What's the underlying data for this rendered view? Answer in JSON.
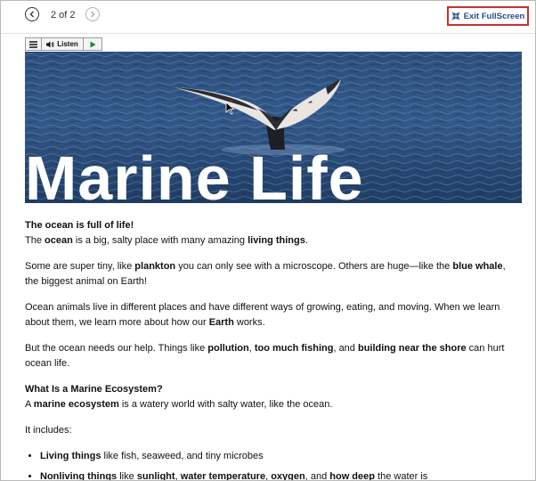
{
  "toolbar": {
    "pager_text": "2 of 2",
    "exit_label": "Exit FullScreen"
  },
  "readspeaker": {
    "listen_label": "Listen"
  },
  "hero": {
    "title": "Marine Life"
  },
  "article": {
    "intro_heading": "The ocean is full of life!",
    "p1": [
      "The ",
      "ocean",
      " is a big, salty place with many amazing ",
      "living things",
      "."
    ],
    "p2": [
      "Some are super tiny, like ",
      "plankton",
      " you can only see with a microscope. Others are huge—like the ",
      "blue whale",
      ", the biggest animal on Earth!"
    ],
    "p3": [
      "Ocean animals live in different places and have different ways of growing, eating, and moving. When we learn about them, we learn more about how our ",
      "Earth",
      " works."
    ],
    "p4": [
      "But the ocean needs our help. Things like ",
      "pollution",
      ", ",
      "too much fishing",
      ", and ",
      "building near the shore",
      " can hurt ocean life."
    ],
    "ecosystem_heading": "What Is a Marine Ecosystem?",
    "p5": [
      " A ",
      "marine ecosystem",
      " is a watery world with salty water, like the ocean."
    ],
    "includes_text": "It includes:",
    "li1": [
      "Living things",
      " like fish, seaweed, and tiny microbes"
    ],
    "li2": [
      "Nonliving things",
      " like ",
      "sunlight",
      ", ",
      "water temperature",
      ", ",
      "oxygen",
      ", and ",
      "how deep",
      " the water is"
    ]
  }
}
